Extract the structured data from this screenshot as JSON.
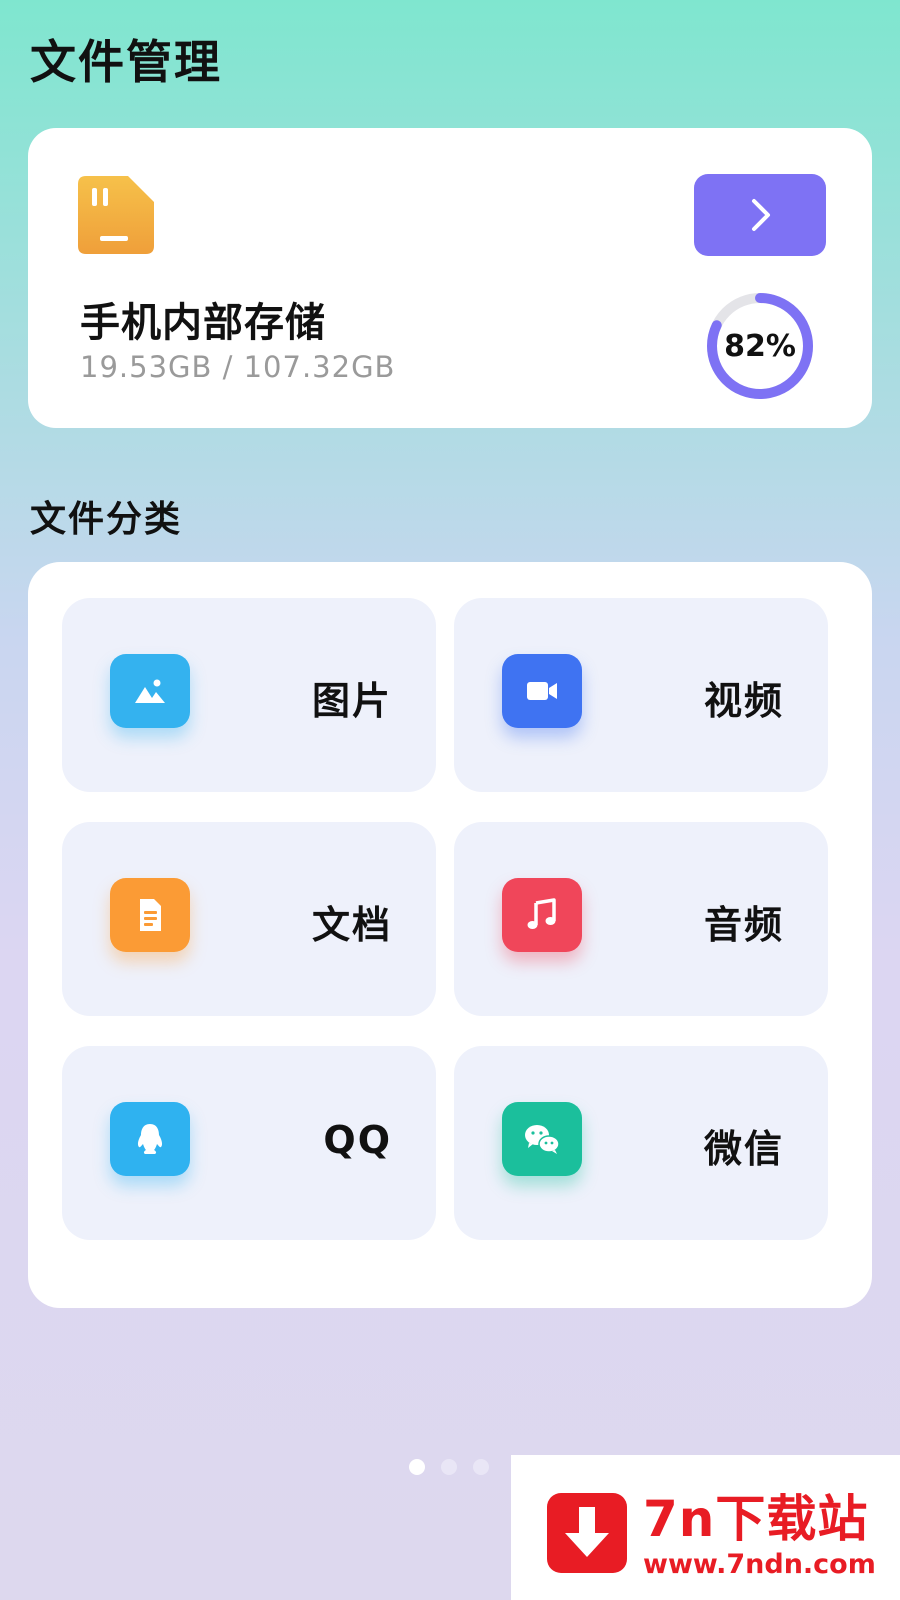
{
  "header": {
    "title": "文件管理"
  },
  "storage": {
    "name": "手机内部存储",
    "size": "19.53GB / 107.32GB",
    "percent_label": "82%",
    "percent_value": 0.82,
    "go_icon": "chevron-right-icon",
    "folder_icon": "sd-card-icon",
    "colors": {
      "accent": "#7e72f4",
      "folder": "#f2a73b"
    }
  },
  "categories": {
    "title": "文件分类",
    "items": [
      {
        "label": "图片",
        "icon": "image-icon",
        "color": "#34b2ef"
      },
      {
        "label": "视频",
        "icon": "video-camera-icon",
        "color": "#3f73f2"
      },
      {
        "label": "文档",
        "icon": "document-icon",
        "color": "#fb9b35"
      },
      {
        "label": "音频",
        "icon": "music-note-icon",
        "color": "#f0465a"
      },
      {
        "label": "QQ",
        "icon": "qq-penguin-icon",
        "color": "#2fb2f0"
      },
      {
        "label": "微信",
        "icon": "wechat-icon",
        "color": "#1bbf9c"
      }
    ]
  },
  "pager": {
    "count": 3,
    "active": 0
  },
  "watermark": {
    "title": "7n下载站",
    "url": "www.7ndn.com"
  }
}
